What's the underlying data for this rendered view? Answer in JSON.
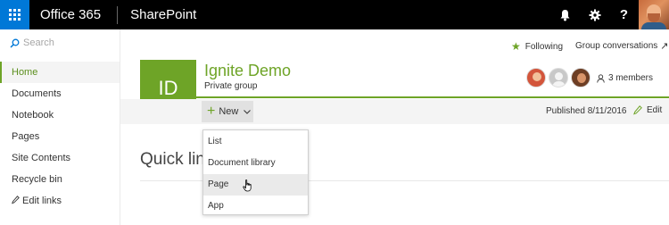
{
  "suitebar": {
    "app_launcher_icon": "waffle-icon",
    "product": "Office 365",
    "app": "SharePoint",
    "notification_icon": "bell-icon",
    "settings_icon": "gear-icon",
    "help_label": "?",
    "accent_color": "#0078d7"
  },
  "leftnav": {
    "search_placeholder": "Search",
    "items": [
      {
        "label": "Home",
        "selected": true
      },
      {
        "label": "Documents"
      },
      {
        "label": "Notebook"
      },
      {
        "label": "Pages"
      },
      {
        "label": "Site Contents"
      },
      {
        "label": "Recycle bin"
      },
      {
        "label": "Edit links",
        "icon": "pencil-icon"
      }
    ]
  },
  "header": {
    "following": "Following",
    "group_conversations": "Group conversations",
    "logo_initials": "ID",
    "site_title": "Ignite Demo",
    "site_subtitle": "Private group",
    "members": "3 members",
    "brand_color": "#6ea427"
  },
  "commandbar": {
    "new_label": "New",
    "published": "Published 8/11/2016",
    "edit_label": "Edit"
  },
  "new_menu": {
    "items": [
      {
        "label": "List"
      },
      {
        "label": "Document library"
      },
      {
        "label": "Page",
        "hovered": true
      },
      {
        "label": "App"
      }
    ]
  },
  "content": {
    "section_title": "Quick links"
  }
}
